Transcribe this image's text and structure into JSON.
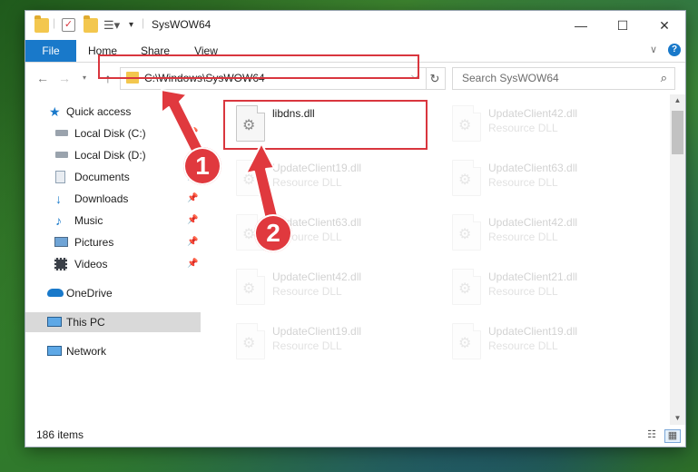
{
  "window": {
    "title": "SysWOW64",
    "controls": {
      "minimize": "—",
      "maximize": "☐",
      "close": "✕"
    }
  },
  "ribbon": {
    "tabs": [
      "File",
      "Home",
      "Share",
      "View"
    ]
  },
  "address": {
    "path": "C:\\Windows\\SysWOW64",
    "search_placeholder": "Search SysWOW64"
  },
  "sidebar": {
    "quick_access": "Quick access",
    "items": [
      {
        "label": "Local Disk (C:)",
        "icon": "drive-icon",
        "pinned": true
      },
      {
        "label": "Local Disk (D:)",
        "icon": "drive-icon",
        "pinned": false
      },
      {
        "label": "Documents",
        "icon": "documents-icon",
        "pinned": true
      },
      {
        "label": "Downloads",
        "icon": "downloads-icon",
        "pinned": true
      },
      {
        "label": "Music",
        "icon": "music-icon",
        "pinned": true
      },
      {
        "label": "Pictures",
        "icon": "pictures-icon",
        "pinned": true
      },
      {
        "label": "Videos",
        "icon": "videos-icon",
        "pinned": true
      }
    ],
    "onedrive": "OneDrive",
    "this_pc": "This PC",
    "network": "Network"
  },
  "files": [
    {
      "name": "libdns.dll",
      "type": "",
      "highlighted": true
    },
    {
      "name": "UpdateClient42.dll",
      "type": "Resource DLL"
    },
    {
      "name": "UpdateClient19.dll",
      "type": "Resource DLL"
    },
    {
      "name": "UpdateClient63.dll",
      "type": "Resource DLL"
    },
    {
      "name": "UpdateClient63.dll",
      "type": "Resource DLL"
    },
    {
      "name": "UpdateClient42.dll",
      "type": "Resource DLL"
    },
    {
      "name": "UpdateClient42.dll",
      "type": "Resource DLL"
    },
    {
      "name": "UpdateClient21.dll",
      "type": "Resource DLL"
    },
    {
      "name": "UpdateClient19.dll",
      "type": "Resource DLL"
    },
    {
      "name": "UpdateClient19.dll",
      "type": "Resource DLL"
    }
  ],
  "status": {
    "count": "186 items"
  },
  "callouts": {
    "one": "1",
    "two": "2"
  },
  "colors": {
    "accent": "#1979ca",
    "highlight": "#d9363e",
    "selection": "#d9d9d9"
  }
}
